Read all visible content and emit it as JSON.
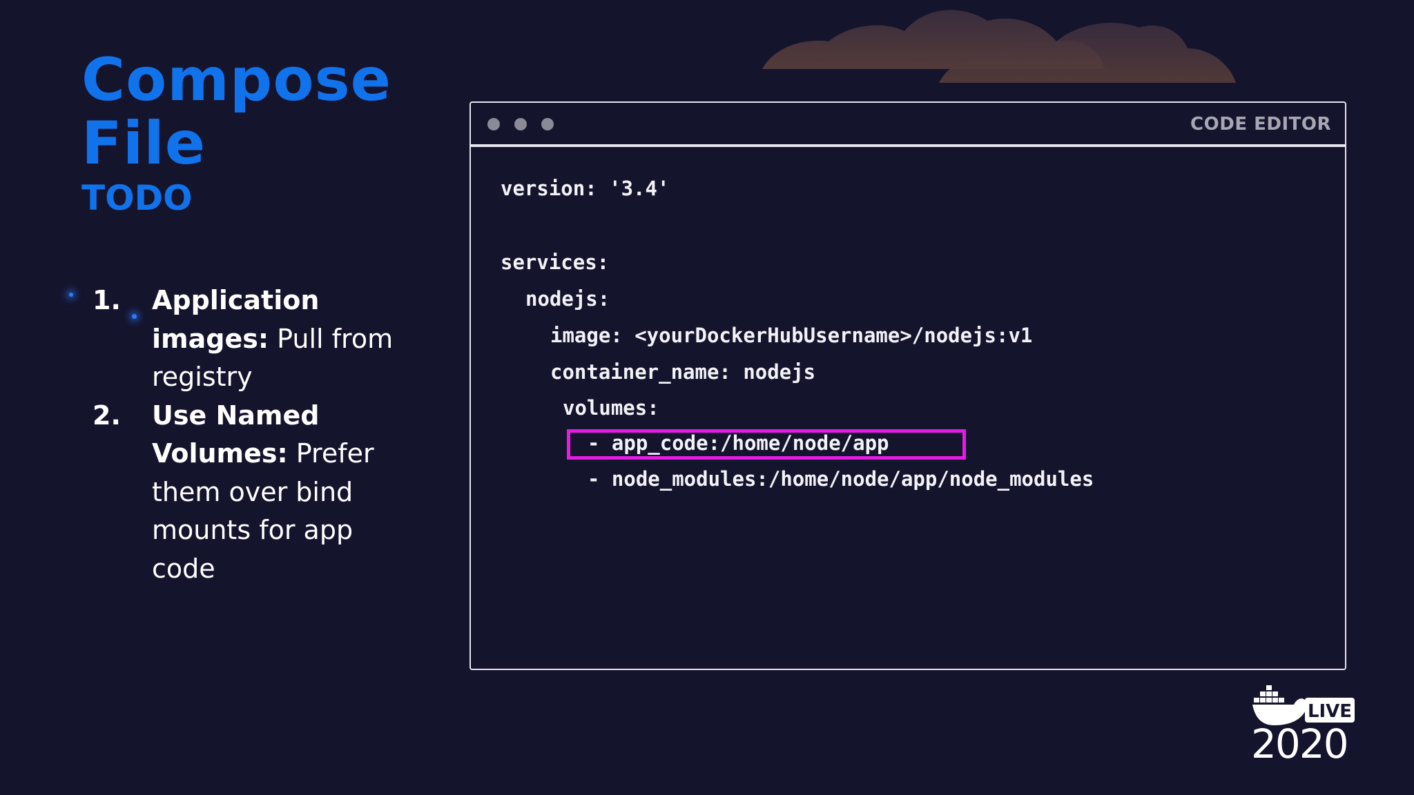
{
  "slide": {
    "title_line1": "Compose",
    "title_line2": "File",
    "subtitle": "TODO"
  },
  "todo": {
    "items": [
      {
        "number": "1.",
        "bold": "Application images:",
        "text": " Pull from registry"
      },
      {
        "number": "2.",
        "bold": "Use Named Volumes:",
        "text": " Prefer them over bind mounts for app code"
      }
    ]
  },
  "editor": {
    "title": "CODE EDITOR",
    "lines": [
      "version: '3.4'",
      "services:",
      "nodejs:",
      "image: <yourDockerHubUsername>/nodejs:v1",
      "container_name: nodejs",
      "volumes:",
      "- app_code:/home/node/app",
      "- node_modules:/home/node/app/node_modules"
    ]
  },
  "logo": {
    "badge": "LIVE",
    "year": "2020",
    "icon": "docker-whale-icon"
  },
  "colors": {
    "background": "#15142d",
    "accent": "#1173ec",
    "highlight": "#e41ce4",
    "cloud": "#5a3f3a"
  }
}
